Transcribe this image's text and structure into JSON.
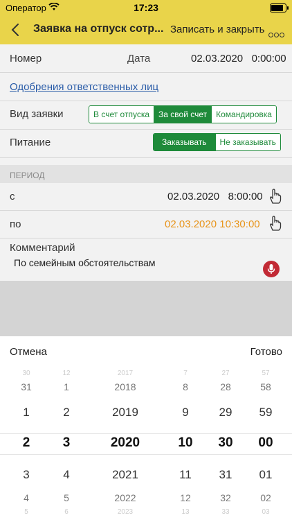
{
  "status_bar": {
    "carrier": "Оператор",
    "time": "17:23",
    "battery_percent": 90
  },
  "nav": {
    "title": "Заявка на отпуск сотр...",
    "save_close": "Записать и закрыть"
  },
  "form": {
    "number_label": "Номер",
    "date_label": "Дата",
    "date_value": "02.03.2020   0:00:00",
    "approvals_link": "Одобрения ответственных лиц",
    "request_type_label": "Вид заявки",
    "request_type_options": [
      "В счет отпуска",
      "За свой счет",
      "Командировка"
    ],
    "request_type_selected": 1,
    "meal_label": "Питание",
    "meal_options": [
      "Заказывать",
      "Не заказывать"
    ],
    "meal_selected": 0,
    "period_header": "ПЕРИОД",
    "from_label": "с",
    "from_value": "02.03.2020   8:00:00",
    "to_label": "по",
    "to_value": "02.03.2020 10:30:00",
    "to_value_color": "#e8941a",
    "comment_label": "Комментарий",
    "comment_value": "По семейным обстоятельствам"
  },
  "picker": {
    "cancel": "Отмена",
    "done": "Готово",
    "columns": [
      [
        "30",
        "31",
        "1",
        "2",
        "3",
        "4",
        "5"
      ],
      [
        "12",
        "1",
        "2",
        "3",
        "4",
        "5",
        "6"
      ],
      [
        "2017",
        "2018",
        "2019",
        "2020",
        "2021",
        "2022",
        "2023"
      ],
      [
        "7",
        "8",
        "9",
        "10",
        "11",
        "12",
        "13"
      ],
      [
        "27",
        "28",
        "29",
        "30",
        "31",
        "32",
        "33"
      ],
      [
        "57",
        "58",
        "59",
        "00",
        "01",
        "02",
        "03"
      ]
    ]
  },
  "colors": {
    "accent": "#e9d44a",
    "green": "#1e8a3a",
    "link": "#2a5ca8",
    "mic": "#c22a35"
  },
  "icons": [
    "wifi-icon",
    "battery-icon",
    "back-chevron-icon",
    "more-icon",
    "tap-hand-icon",
    "microphone-icon"
  ]
}
